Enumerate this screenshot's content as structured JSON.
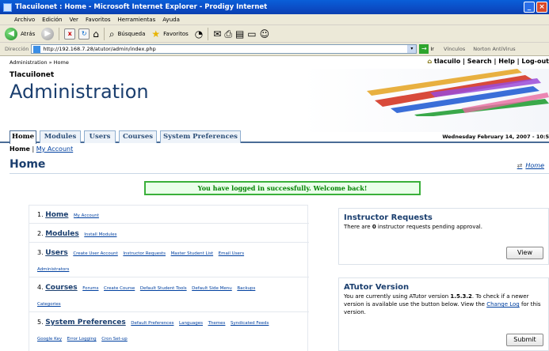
{
  "window": {
    "title": "Tlacuilonet : Home - Microsoft Internet Explorer - Prodigy Internet"
  },
  "menu": [
    "Archivo",
    "Edición",
    "Ver",
    "Favoritos",
    "Herramientas",
    "Ayuda"
  ],
  "toolbar": {
    "back_label": "Atrás",
    "search_label": "Búsqueda",
    "favorites_label": "Favoritos"
  },
  "address": {
    "label": "Dirección",
    "url": "http://192.168.7.28/atutor/admin/index.php",
    "go_label": "Ir",
    "links_label": "Vínculos",
    "norton_label": "Norton AntiVirus"
  },
  "page": {
    "breadcrumb": "Administration » Home",
    "top_user": "tlacuilo",
    "top_links": [
      "Search",
      "Help",
      "Log-out"
    ],
    "site_name": "Tlacuilonet",
    "section_title": "Administration",
    "tabs": [
      "Home",
      "Modules",
      "Users",
      "Courses",
      "System Preferences"
    ],
    "date": "Wednesday February 14, 2007 - 10:5",
    "sub_breadcrumb_current": "Home",
    "sub_breadcrumb_link": "My Account",
    "title": "Home",
    "home_link": "Home",
    "feedback": "You have logged in successfully. Welcome back!"
  },
  "admin_items": [
    {
      "number": "1.",
      "title": "Home",
      "links": [
        "My Account"
      ],
      "extra_links": []
    },
    {
      "number": "2.",
      "title": "Modules",
      "links": [
        "Install Modules"
      ],
      "extra_links": []
    },
    {
      "number": "3.",
      "title": "Users",
      "links": [
        "Create User Account",
        "Instructor Requests",
        "Master Student List",
        "Email Users"
      ],
      "extra_links": [
        "Administrators"
      ]
    },
    {
      "number": "4.",
      "title": "Courses",
      "links": [
        "Forums",
        "Create Course",
        "Default Student Tools",
        "Default Side Menu",
        "Backups"
      ],
      "extra_links": [
        "Categories"
      ]
    },
    {
      "number": "5.",
      "title": "System Preferences",
      "links": [
        "Default Preferences",
        "Languages",
        "Themes",
        "Syndicated Feeds"
      ],
      "extra_links": [
        "Google Key",
        "Error Logging",
        "Cron Set-up"
      ]
    }
  ],
  "instructor_requests": {
    "title": "Instructor Requests",
    "text_before": "There are ",
    "count": "0",
    "text_after": " instructor requests pending approval.",
    "button": "View"
  },
  "atutor_version": {
    "title": "ATutor Version",
    "text_before": "You are currently using ATutor version ",
    "version": "1.5.3.2",
    "text_after": ". To check if a newer version is available use the button below. View the ",
    "link": "Change Log",
    "text_end": " for this version.",
    "button": "Submit"
  },
  "colors": {
    "titlebar": "#0b4bc4",
    "heading": "#1a3e6e",
    "link": "#0040a0",
    "success_border": "#3ab03a",
    "success_text": "#008000"
  }
}
